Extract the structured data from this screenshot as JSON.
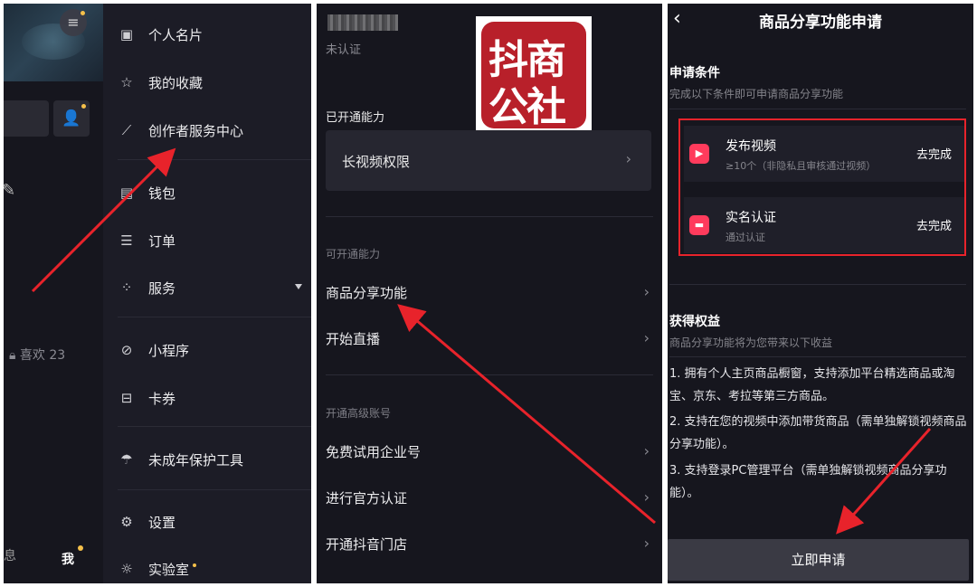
{
  "panel1": {
    "left_column": {
      "like_label": "喜欢 23",
      "bottom_partial_label": "息",
      "me_tab": "我"
    },
    "drawer": {
      "items": [
        {
          "icon": "id-card-icon",
          "label": "个人名片"
        },
        {
          "icon": "star-icon",
          "label": "我的收藏"
        },
        {
          "icon": "chart-icon",
          "label": "创作者服务中心"
        },
        {
          "icon": "wallet-icon",
          "label": "钱包"
        },
        {
          "icon": "order-icon",
          "label": "订单"
        },
        {
          "icon": "grid-icon",
          "label": "服务"
        },
        {
          "icon": "mini-program-icon",
          "label": "小程序"
        },
        {
          "icon": "ticket-icon",
          "label": "卡券"
        },
        {
          "icon": "umbrella-icon",
          "label": "未成年保护工具"
        },
        {
          "icon": "gear-icon",
          "label": "设置"
        },
        {
          "icon": "bulb-icon",
          "label": "实验室"
        }
      ]
    }
  },
  "panel2": {
    "unverified": "未认证",
    "logo": {
      "line1": "抖商",
      "line2": "公社"
    },
    "opened_section": "已开通能力",
    "opened_items": [
      "长视频权限"
    ],
    "available_section": "可开通能力",
    "available_items": [
      "商品分享功能",
      "开始直播"
    ],
    "advanced_section": "开通高级账号",
    "advanced_items": [
      "免费试用企业号",
      "进行官方认证",
      "开通抖音门店"
    ]
  },
  "panel3": {
    "title": "商品分享功能申请",
    "conditions_label": "申请条件",
    "conditions_sub": "完成以下条件即可申请商品分享功能",
    "conditions": [
      {
        "title": "发布视频",
        "desc": "≥10个（非隐私且审核通过视频）",
        "action": "去完成"
      },
      {
        "title": "实名认证",
        "desc": "通过认证",
        "action": "去完成"
      }
    ],
    "benefits_label": "获得权益",
    "benefits_sub": "商品分享功能将为您带来以下收益",
    "benefits": [
      "1. 拥有个人主页商品橱窗，支持添加平台精选商品或淘宝、京东、考拉等第三方商品。",
      "2. 支持在您的视频中添加带货商品（需单独解锁视频商品分享功能）。",
      "3. 支持登录PC管理平台（需单独解锁视频商品分享功能）。"
    ],
    "apply_button": "立即申请"
  },
  "colors": {
    "background": "#16161e",
    "card": "#262630",
    "accent_red": "#e8232b",
    "icon_pink": "#ff3b5c",
    "dot_yellow": "#f5c04a"
  }
}
